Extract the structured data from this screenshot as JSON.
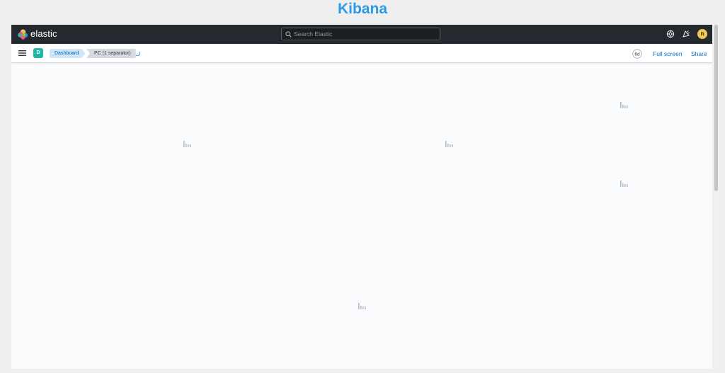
{
  "page_title": "Kibana",
  "header": {
    "logo_text": "elastic",
    "search": {
      "placeholder": "Search Elastic",
      "value": ""
    },
    "icons": [
      "help-icon",
      "newsfeed-icon"
    ],
    "user_avatar": "n"
  },
  "subheader": {
    "space_badge": "D",
    "breadcrumbs": [
      "Dashboard",
      "PC (1 separator)"
    ],
    "zoom_label": "6d",
    "full_screen_label": "Full screen",
    "share_label": "Share"
  },
  "panels": {
    "count": 5,
    "state": "loading"
  },
  "colors": {
    "title": "#2b9be8",
    "header_bg": "#25282f",
    "link": "#0071c2",
    "space_badge": "#1fb8a8",
    "avatar": "#f0c94c",
    "canvas": "#fafbfd"
  }
}
